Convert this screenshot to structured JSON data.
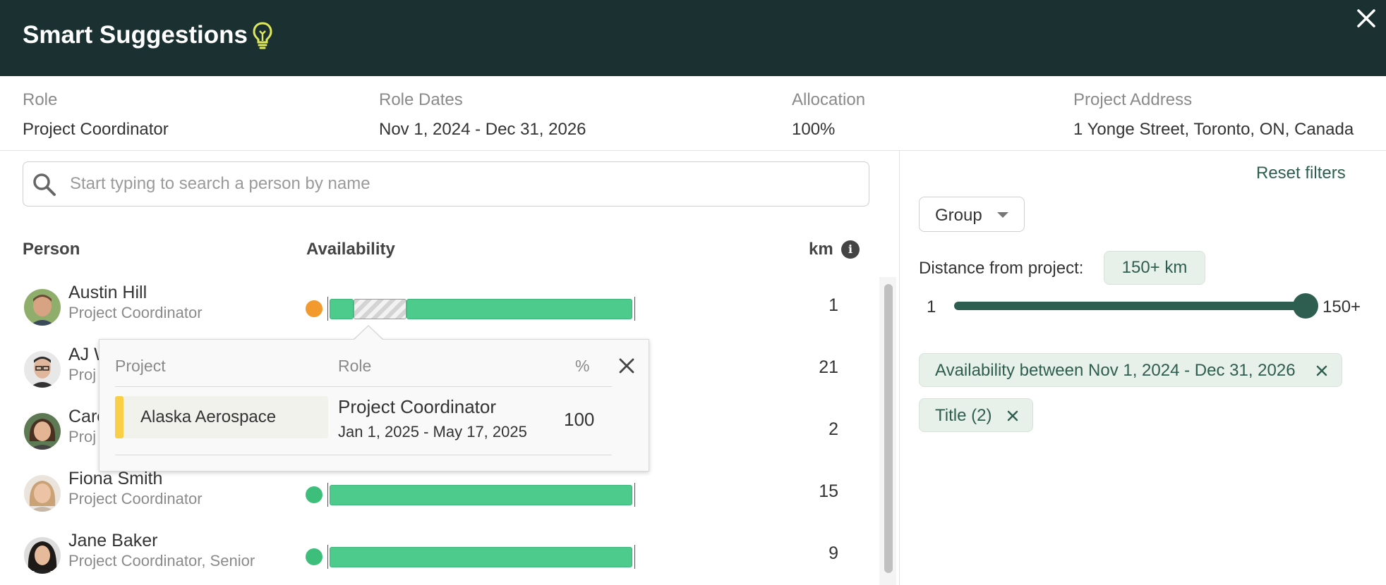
{
  "header": {
    "title": "Smart Suggestions",
    "bulb_icon": "lightbulb-icon",
    "close_icon": "close-icon",
    "bg_color": "#1b3131"
  },
  "role_info": {
    "role": {
      "label": "Role",
      "value": "Project Coordinator"
    },
    "dates": {
      "label": "Role Dates",
      "value": "Nov 1, 2024 - Dec 31, 2026"
    },
    "allocation": {
      "label": "Allocation",
      "value": "100%"
    },
    "address": {
      "label": "Project Address",
      "value": "1 Yonge Street, Toronto, ON, Canada"
    }
  },
  "search": {
    "placeholder": "Start typing to search a person by name",
    "value": ""
  },
  "columns": {
    "person": "Person",
    "availability": "Availability",
    "km": "km"
  },
  "people": [
    {
      "name": "Austin Hill",
      "title": "Project Coordinator",
      "km": "1",
      "status": "partial",
      "status_color": "#f39a2e"
    },
    {
      "name": "AJ W",
      "title": "Proj",
      "km": "21",
      "status": "available",
      "status_color": "#3dbf7b"
    },
    {
      "name": "Caro",
      "title": "Proj",
      "km": "2",
      "status": "available",
      "status_color": "#3dbf7b"
    },
    {
      "name": "Fiona Smith",
      "title": "Project Coordinator",
      "km": "15",
      "status": "available",
      "status_color": "#3dbf7b"
    },
    {
      "name": "Jane Baker",
      "title": "Project Coordinator, Senior",
      "km": "9",
      "status": "available",
      "status_color": "#3dbf7b"
    }
  ],
  "popover": {
    "headers": {
      "project": "Project",
      "role": "Role",
      "percent": "%"
    },
    "rows": [
      {
        "project": "Alaska Aerospace",
        "project_color": "#f8cf46",
        "role": "Project Coordinator",
        "dates": "Jan 1, 2025 - May 17, 2025",
        "percent": "100"
      }
    ]
  },
  "filters": {
    "reset_label": "Reset filters",
    "group_label": "Group",
    "distance_label": "Distance from project:",
    "distance_value": "150+ km",
    "slider": {
      "min_label": "1",
      "max_label": "150+",
      "value_fraction": 1.0
    },
    "chips": [
      {
        "label": "Availability between Nov 1, 2024 - Dec 31, 2026"
      },
      {
        "label": "Title (2)"
      }
    ],
    "accent_color": "#2d5e4f"
  }
}
